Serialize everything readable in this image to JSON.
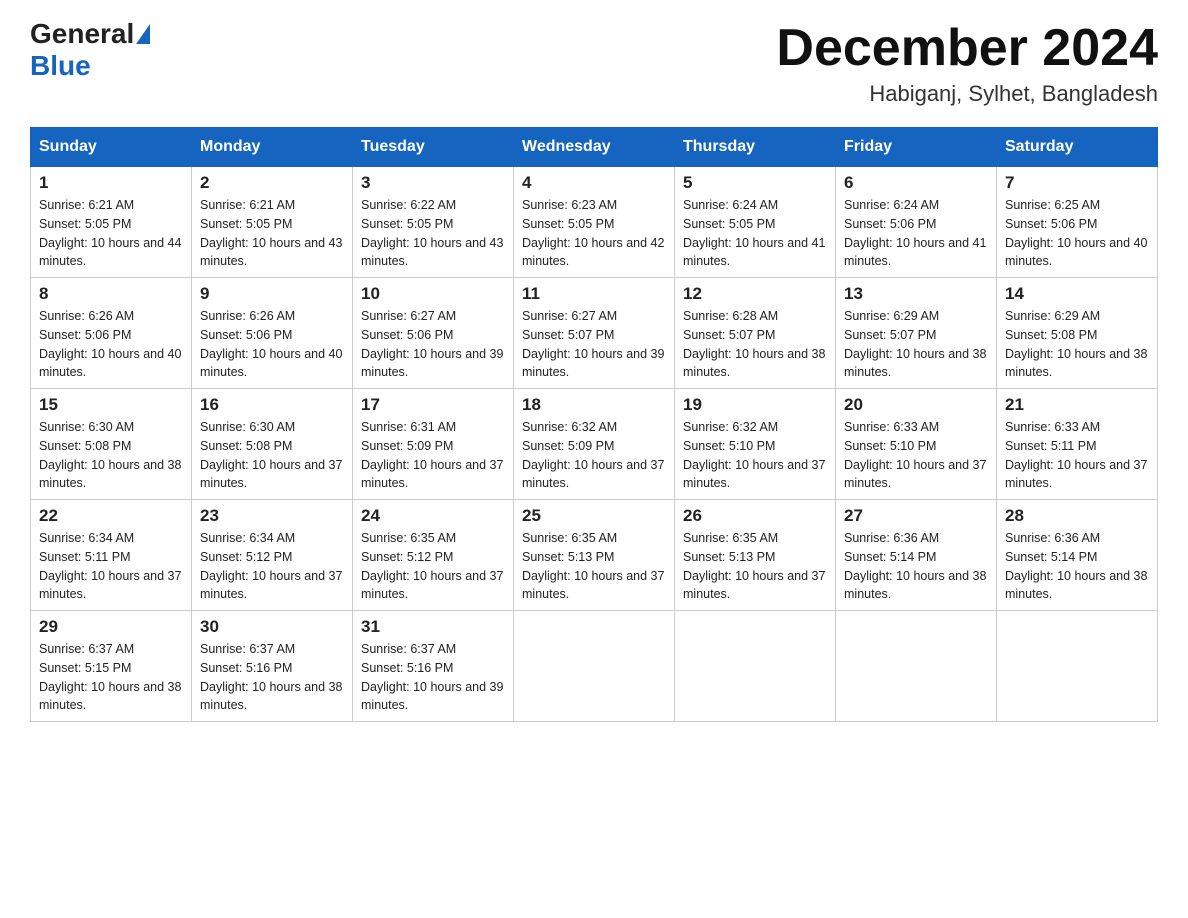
{
  "header": {
    "logo_general": "General",
    "logo_blue": "Blue",
    "month_title": "December 2024",
    "location": "Habiganj, Sylhet, Bangladesh"
  },
  "days_of_week": [
    "Sunday",
    "Monday",
    "Tuesday",
    "Wednesday",
    "Thursday",
    "Friday",
    "Saturday"
  ],
  "weeks": [
    [
      {
        "day": "1",
        "sunrise": "6:21 AM",
        "sunset": "5:05 PM",
        "daylight": "10 hours and 44 minutes."
      },
      {
        "day": "2",
        "sunrise": "6:21 AM",
        "sunset": "5:05 PM",
        "daylight": "10 hours and 43 minutes."
      },
      {
        "day": "3",
        "sunrise": "6:22 AM",
        "sunset": "5:05 PM",
        "daylight": "10 hours and 43 minutes."
      },
      {
        "day": "4",
        "sunrise": "6:23 AM",
        "sunset": "5:05 PM",
        "daylight": "10 hours and 42 minutes."
      },
      {
        "day": "5",
        "sunrise": "6:24 AM",
        "sunset": "5:05 PM",
        "daylight": "10 hours and 41 minutes."
      },
      {
        "day": "6",
        "sunrise": "6:24 AM",
        "sunset": "5:06 PM",
        "daylight": "10 hours and 41 minutes."
      },
      {
        "day": "7",
        "sunrise": "6:25 AM",
        "sunset": "5:06 PM",
        "daylight": "10 hours and 40 minutes."
      }
    ],
    [
      {
        "day": "8",
        "sunrise": "6:26 AM",
        "sunset": "5:06 PM",
        "daylight": "10 hours and 40 minutes."
      },
      {
        "day": "9",
        "sunrise": "6:26 AM",
        "sunset": "5:06 PM",
        "daylight": "10 hours and 40 minutes."
      },
      {
        "day": "10",
        "sunrise": "6:27 AM",
        "sunset": "5:06 PM",
        "daylight": "10 hours and 39 minutes."
      },
      {
        "day": "11",
        "sunrise": "6:27 AM",
        "sunset": "5:07 PM",
        "daylight": "10 hours and 39 minutes."
      },
      {
        "day": "12",
        "sunrise": "6:28 AM",
        "sunset": "5:07 PM",
        "daylight": "10 hours and 38 minutes."
      },
      {
        "day": "13",
        "sunrise": "6:29 AM",
        "sunset": "5:07 PM",
        "daylight": "10 hours and 38 minutes."
      },
      {
        "day": "14",
        "sunrise": "6:29 AM",
        "sunset": "5:08 PM",
        "daylight": "10 hours and 38 minutes."
      }
    ],
    [
      {
        "day": "15",
        "sunrise": "6:30 AM",
        "sunset": "5:08 PM",
        "daylight": "10 hours and 38 minutes."
      },
      {
        "day": "16",
        "sunrise": "6:30 AM",
        "sunset": "5:08 PM",
        "daylight": "10 hours and 37 minutes."
      },
      {
        "day": "17",
        "sunrise": "6:31 AM",
        "sunset": "5:09 PM",
        "daylight": "10 hours and 37 minutes."
      },
      {
        "day": "18",
        "sunrise": "6:32 AM",
        "sunset": "5:09 PM",
        "daylight": "10 hours and 37 minutes."
      },
      {
        "day": "19",
        "sunrise": "6:32 AM",
        "sunset": "5:10 PM",
        "daylight": "10 hours and 37 minutes."
      },
      {
        "day": "20",
        "sunrise": "6:33 AM",
        "sunset": "5:10 PM",
        "daylight": "10 hours and 37 minutes."
      },
      {
        "day": "21",
        "sunrise": "6:33 AM",
        "sunset": "5:11 PM",
        "daylight": "10 hours and 37 minutes."
      }
    ],
    [
      {
        "day": "22",
        "sunrise": "6:34 AM",
        "sunset": "5:11 PM",
        "daylight": "10 hours and 37 minutes."
      },
      {
        "day": "23",
        "sunrise": "6:34 AM",
        "sunset": "5:12 PM",
        "daylight": "10 hours and 37 minutes."
      },
      {
        "day": "24",
        "sunrise": "6:35 AM",
        "sunset": "5:12 PM",
        "daylight": "10 hours and 37 minutes."
      },
      {
        "day": "25",
        "sunrise": "6:35 AM",
        "sunset": "5:13 PM",
        "daylight": "10 hours and 37 minutes."
      },
      {
        "day": "26",
        "sunrise": "6:35 AM",
        "sunset": "5:13 PM",
        "daylight": "10 hours and 37 minutes."
      },
      {
        "day": "27",
        "sunrise": "6:36 AM",
        "sunset": "5:14 PM",
        "daylight": "10 hours and 38 minutes."
      },
      {
        "day": "28",
        "sunrise": "6:36 AM",
        "sunset": "5:14 PM",
        "daylight": "10 hours and 38 minutes."
      }
    ],
    [
      {
        "day": "29",
        "sunrise": "6:37 AM",
        "sunset": "5:15 PM",
        "daylight": "10 hours and 38 minutes."
      },
      {
        "day": "30",
        "sunrise": "6:37 AM",
        "sunset": "5:16 PM",
        "daylight": "10 hours and 38 minutes."
      },
      {
        "day": "31",
        "sunrise": "6:37 AM",
        "sunset": "5:16 PM",
        "daylight": "10 hours and 39 minutes."
      },
      null,
      null,
      null,
      null
    ]
  ]
}
